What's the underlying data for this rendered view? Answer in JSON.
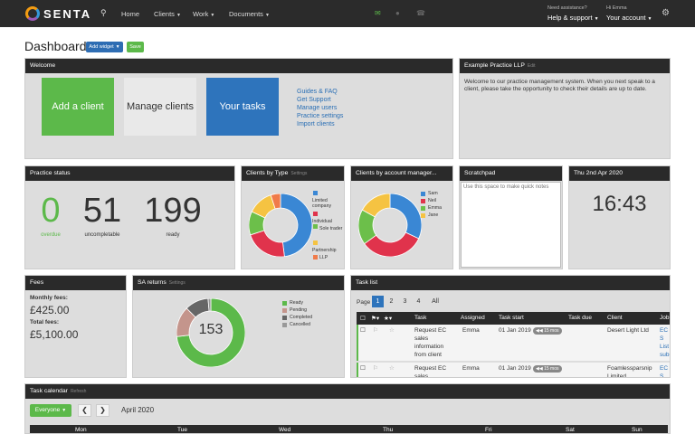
{
  "nav": {
    "brand": "SENTA",
    "home": "Home",
    "clients": "Clients",
    "work": "Work",
    "documents": "Documents",
    "need_assistance": "Need assistance?",
    "help": "Help & support",
    "greeting": "Hi Emma",
    "account": "Your account"
  },
  "header": {
    "title": "Dashboard",
    "add_widget": "Add widget",
    "save": "Save"
  },
  "welcome": {
    "title": "Welcome",
    "tile_add": "Add a client",
    "tile_manage": "Manage clients",
    "tile_tasks": "Your tasks",
    "links": [
      "Guides & FAQ",
      "Get Support",
      "Manage users",
      "Practice settings",
      "Import clients"
    ]
  },
  "practice": {
    "title": "Example Practice LLP",
    "edit": "Edit",
    "text": "Welcome to our practice management system.  When you next speak to a client, please take the opportunity to check their details are up to date."
  },
  "status": {
    "title": "Practice status",
    "overdue": "0",
    "overdue_label": "overdue",
    "uncompletable": "51",
    "uncompletable_label": "uncompletable",
    "ready": "199",
    "ready_label": "ready"
  },
  "clients_by_type": {
    "title": "Clients by Type",
    "settings": "Settings",
    "legend": [
      "Limited company",
      "Individual",
      "Sole trader",
      "Partnership",
      "LLP"
    ],
    "chart_data": {
      "type": "pie",
      "values": [
        48,
        22,
        12,
        13,
        5
      ],
      "colors": [
        "#3a87d4",
        "#e0334c",
        "#6cbf4a",
        "#f5c342",
        "#f07b4a"
      ]
    }
  },
  "clients_by_manager": {
    "title": "Clients by account manager...",
    "legend": [
      "Sam",
      "Neil",
      "Emma",
      "Jane"
    ],
    "chart_data": {
      "type": "pie",
      "values": [
        32,
        33,
        18,
        17
      ],
      "colors": [
        "#3a87d4",
        "#e0334c",
        "#6cbf4a",
        "#f5c342"
      ]
    }
  },
  "scratchpad": {
    "title": "Scratchpad",
    "placeholder": "Use this space to make quick notes"
  },
  "clock": {
    "date": "Thu 2nd Apr 2020",
    "time": "16:43"
  },
  "fees": {
    "title": "Fees",
    "monthly_label": "Monthly fees:",
    "monthly": "£425.00",
    "total_label": "Total fees:",
    "total": "£5,100.00"
  },
  "sa_returns": {
    "title": "SA returns",
    "settings": "Settings",
    "center": "153",
    "legend": [
      "Ready",
      "Pending",
      "Completed",
      "Cancelled"
    ],
    "chart_data": {
      "type": "pie",
      "values": [
        112,
        22,
        17,
        2
      ],
      "colors": [
        "#5cb94a",
        "#c4958c",
        "#666666",
        "#999999"
      ]
    }
  },
  "tasks": {
    "title": "Task list",
    "page_label": "Page",
    "pages": [
      "1",
      "2",
      "3",
      "4",
      "All"
    ],
    "headers": [
      "Task",
      "Assigned",
      "Task start",
      "Task due",
      "Client",
      "Job"
    ],
    "rows": [
      {
        "task": "Request EC sales information from client",
        "assigned": "Emma",
        "start": "01 Jan 2019",
        "badge": "15 mos",
        "due": "",
        "client": "Desert Light Ltd",
        "job": "EC S List subr"
      },
      {
        "task": "Request EC sales",
        "assigned": "Emma",
        "start": "01 Jan 2019",
        "badge": "15 mos",
        "due": "",
        "client": "Foamlessparsnip Limited",
        "job": "EC S List"
      }
    ]
  },
  "calendar": {
    "title": "Task calendar",
    "refresh": "Refresh",
    "filter": "Everyone",
    "month": "April 2020",
    "days": [
      "Mon",
      "Tue",
      "Wed",
      "Thu",
      "Fri",
      "Sat",
      "Sun"
    ]
  }
}
